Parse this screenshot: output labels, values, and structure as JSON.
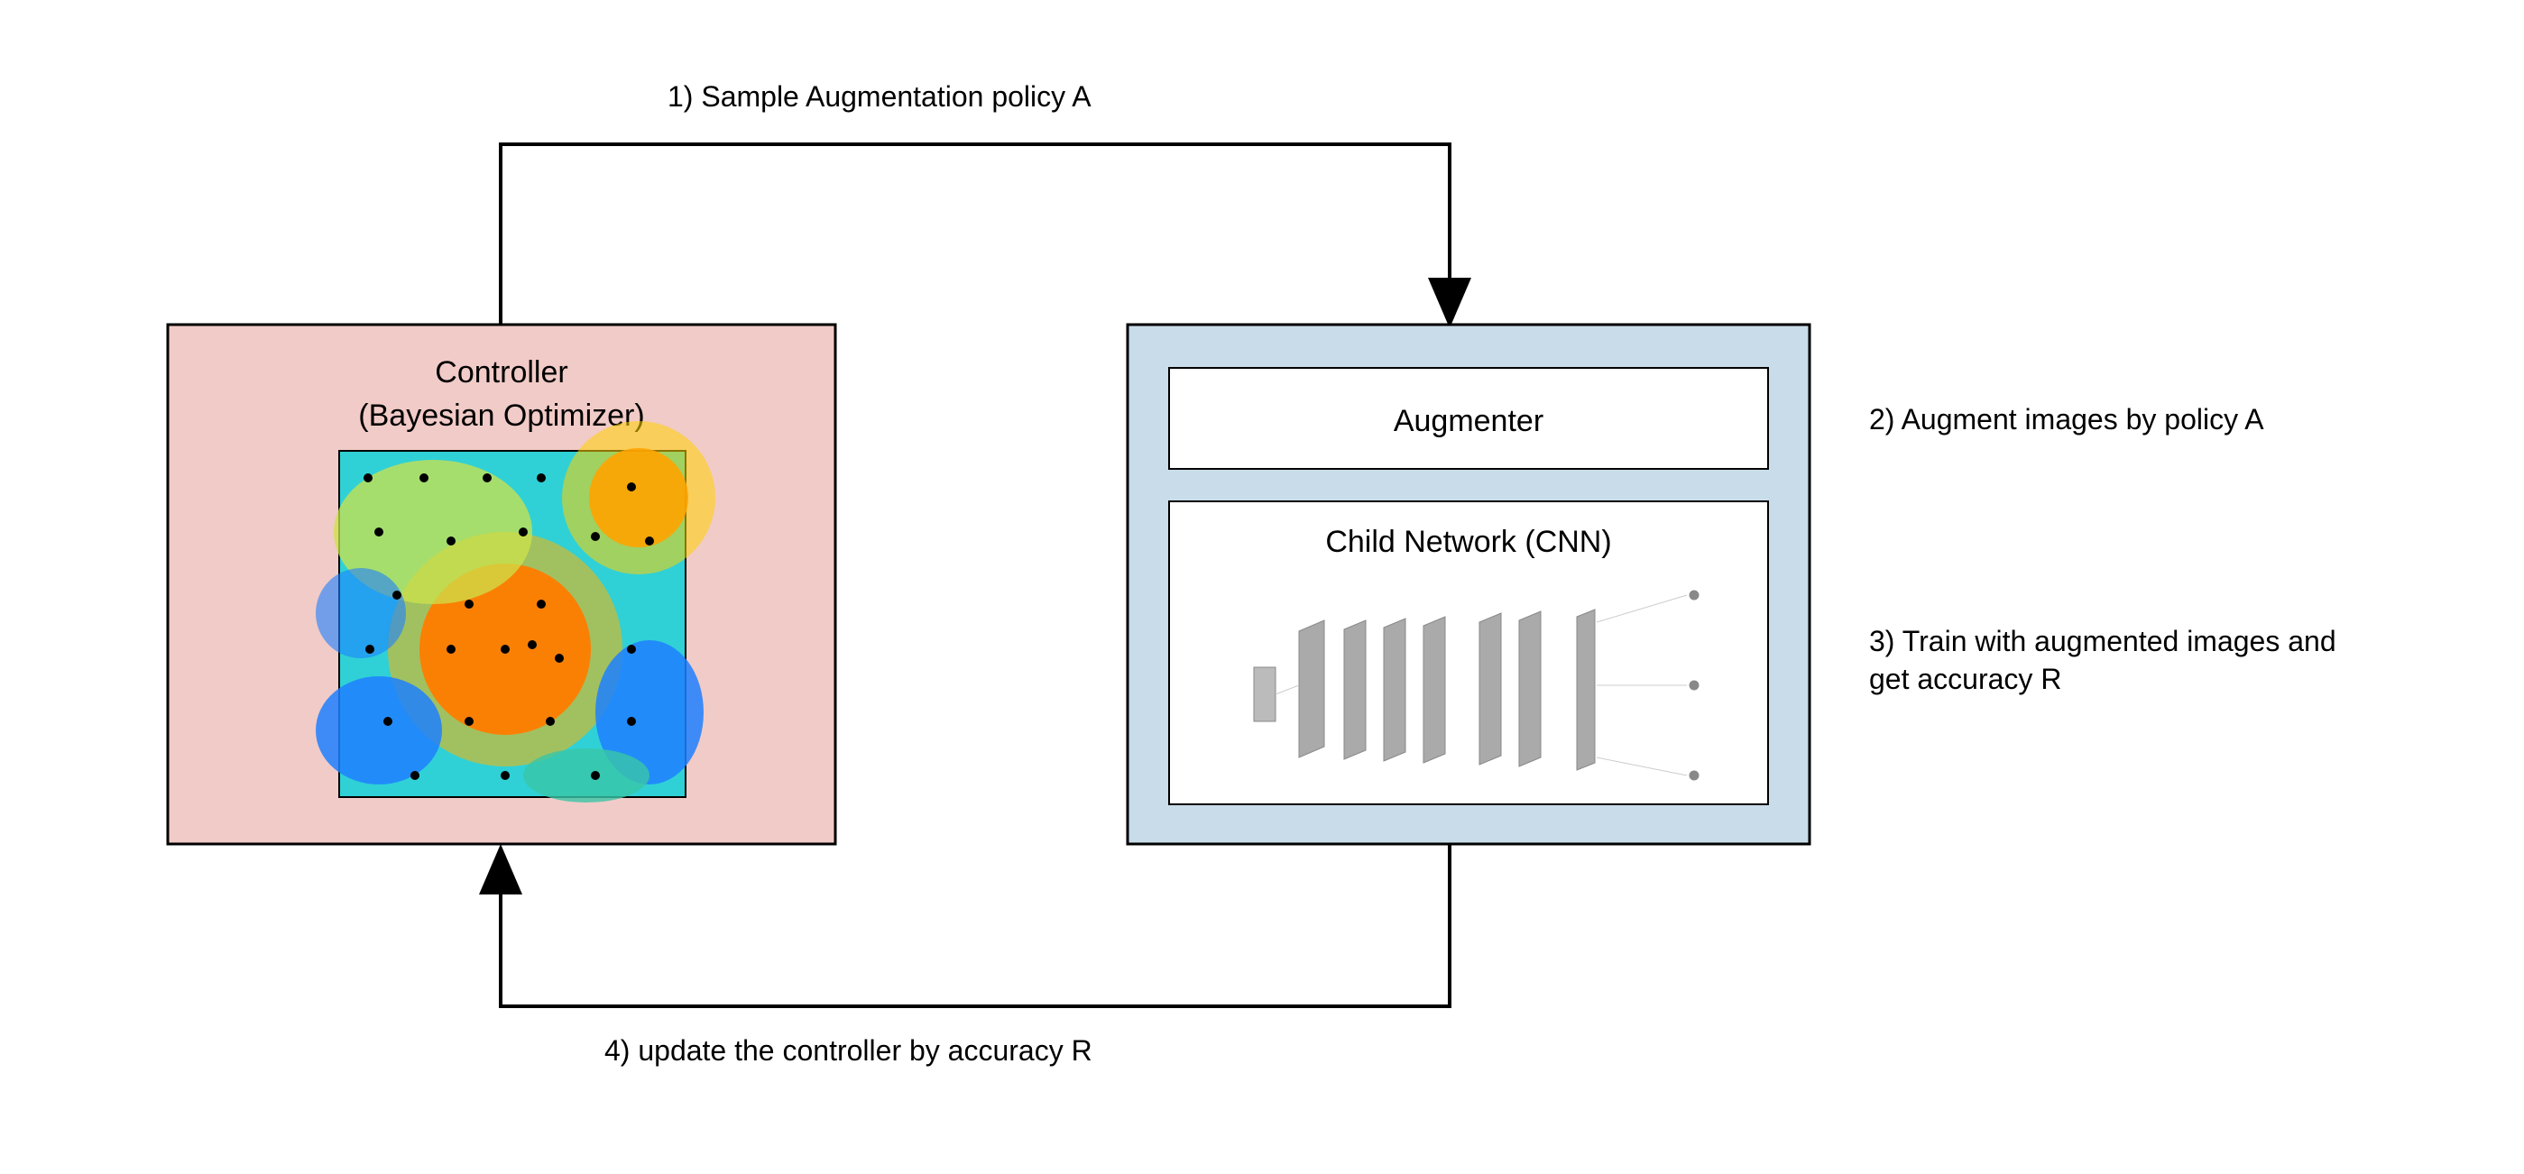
{
  "controller": {
    "title_line1": "Controller",
    "title_line2": "(Bayesian Optimizer)"
  },
  "child": {
    "augmenter_label": "Augmenter",
    "cnn_label": "Child Network (CNN)"
  },
  "steps": {
    "step1": "1)   Sample Augmentation policy A",
    "step2": "2) Augment images by policy A",
    "step3a": "3) Train with augmented images and",
    "step3b": "get accuracy R",
    "step4": "4) update the controller by accuracy R"
  }
}
